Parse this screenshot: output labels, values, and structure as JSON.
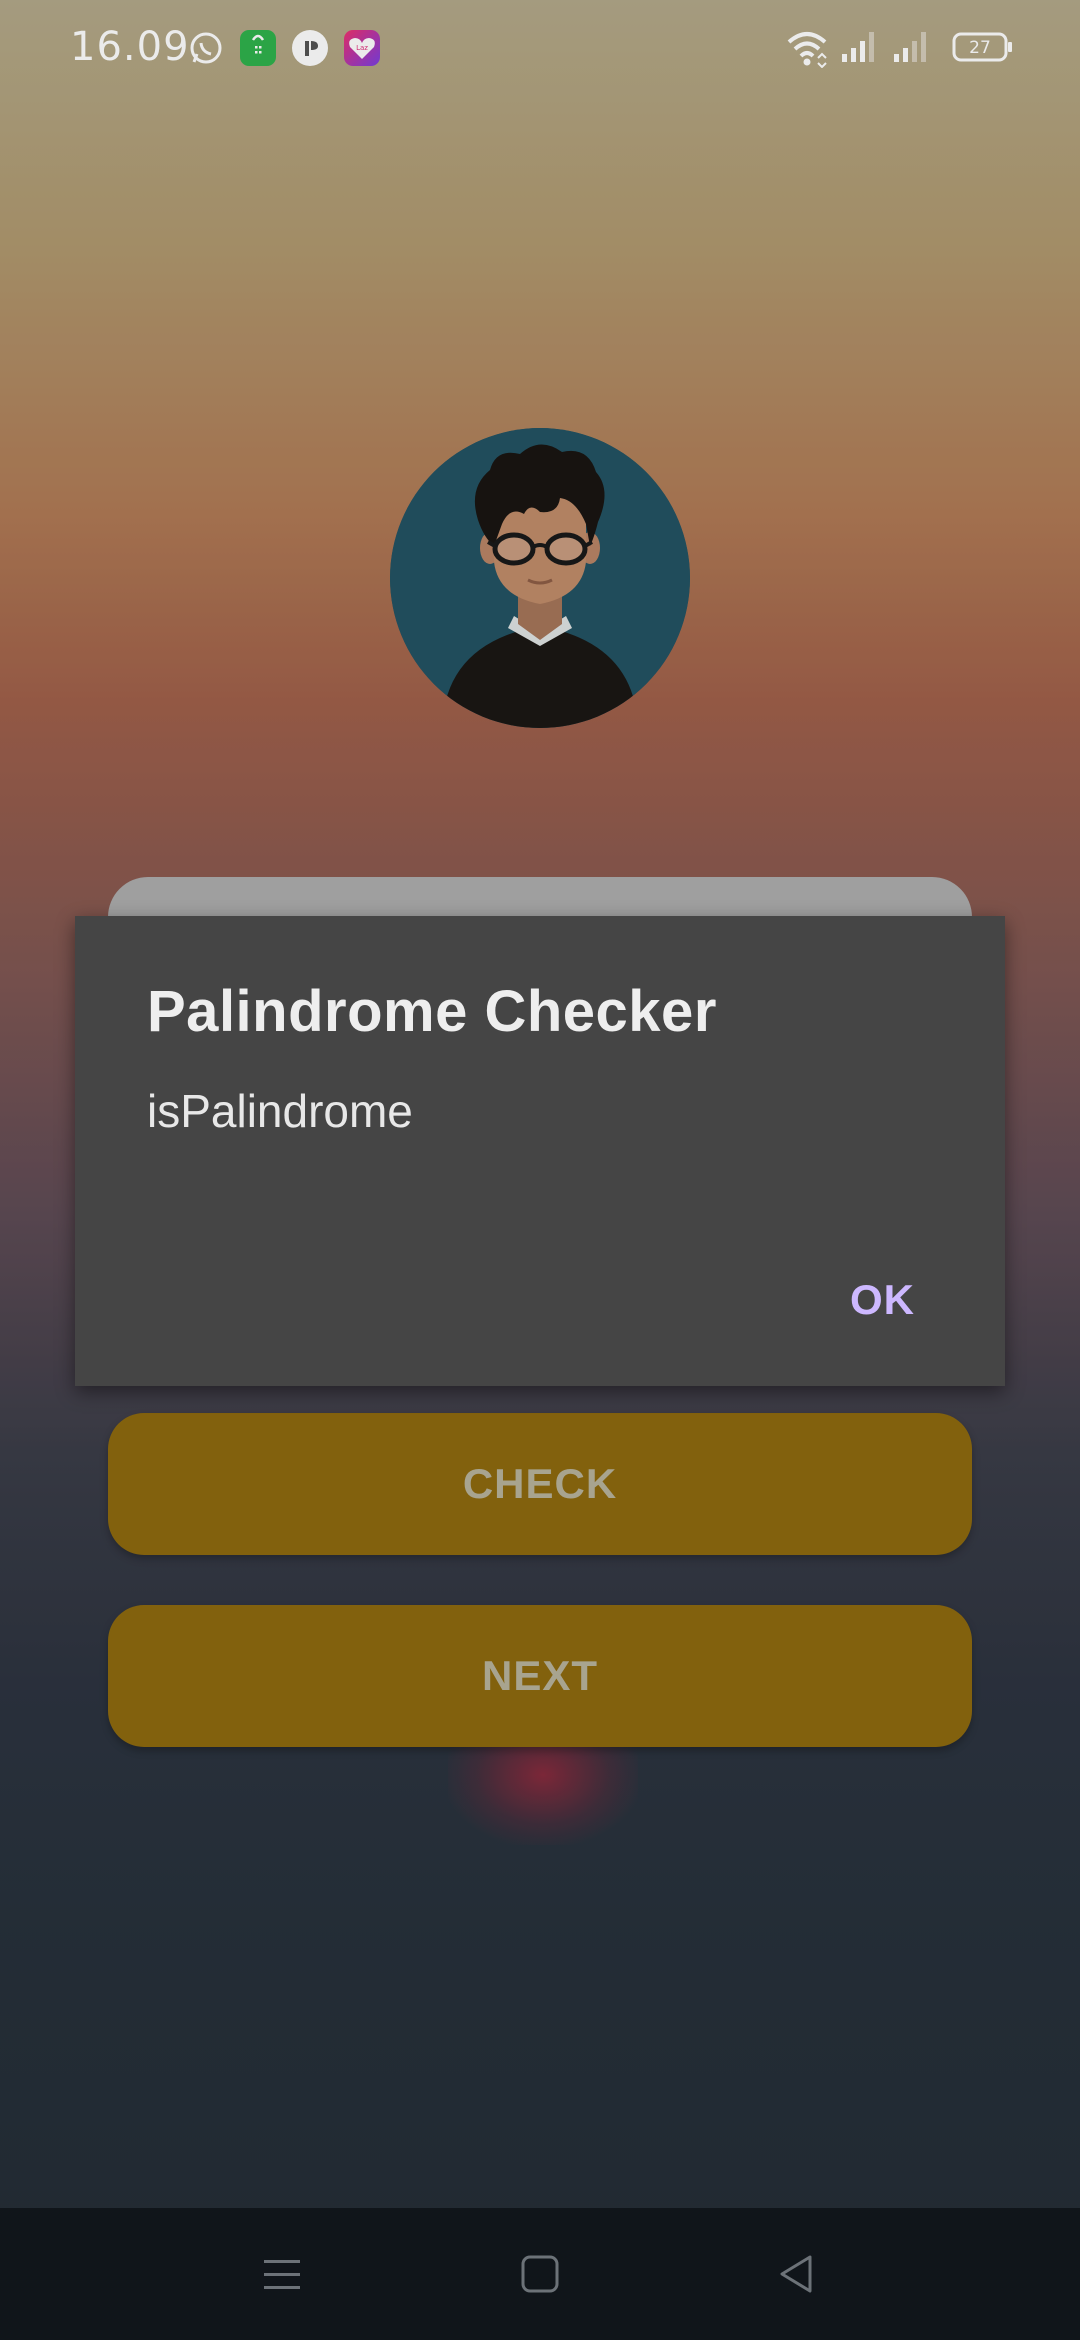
{
  "status_bar": {
    "time": "16.09",
    "battery": "27",
    "notification_icons": [
      "whatsapp-icon",
      "store-icon",
      "app-icon",
      "lazada-icon"
    ],
    "lazada_text": "Laz"
  },
  "dialog": {
    "title": "Palindrome Checker",
    "message": "isPalindrome",
    "ok_label": "OK"
  },
  "buttons": {
    "check_label": "CHECK",
    "next_label": "NEXT"
  },
  "colors": {
    "button_bg": "#8e6a0f",
    "dialog_bg": "#454545",
    "dialog_action": "#cdb8ff",
    "avatar_bg": "#235363"
  }
}
